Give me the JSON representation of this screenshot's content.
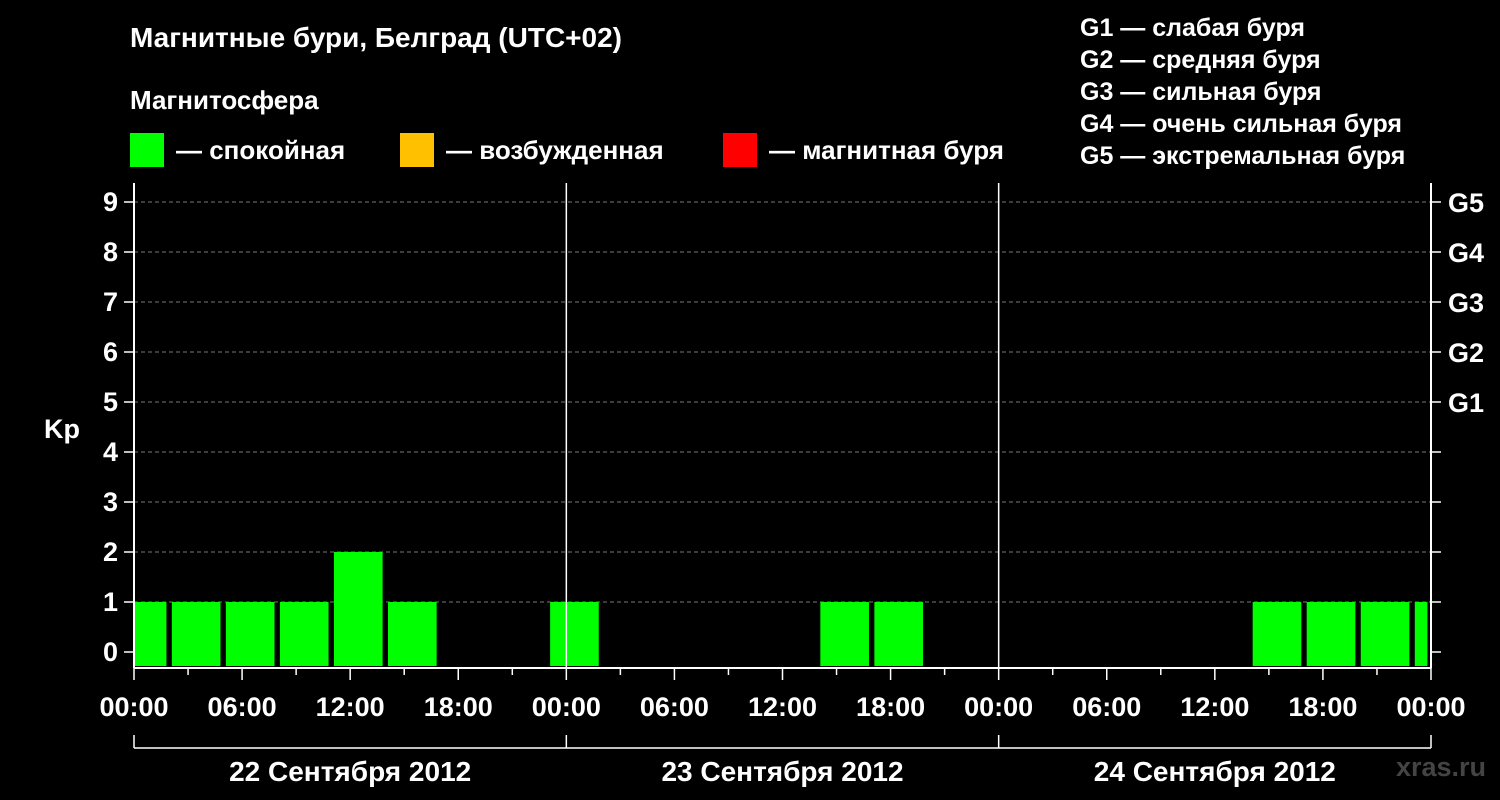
{
  "title": "Магнитные бури, Белград (UTC+02)",
  "magnetosphere": {
    "title": "Магнитосфера",
    "legend": [
      {
        "label": "— спокойная",
        "color": "#00ff00"
      },
      {
        "label": "— возбужденная",
        "color": "#ffc000"
      },
      {
        "label": "— магнитная буря",
        "color": "#ff0000"
      }
    ]
  },
  "g_scale_legend": [
    "G1 — слабая буря",
    "G2 — средняя буря",
    "G3 — сильная буря",
    "G4 — очень сильная буря",
    "G5 — экстремальная буря"
  ],
  "watermark": "xras.ru",
  "chart_data": {
    "type": "bar",
    "ylabel": "Kp",
    "xlabel": "",
    "ylim": [
      0,
      9
    ],
    "xlim_hours": [
      0,
      72
    ],
    "bar_width_hours": 3,
    "y_ticks": [
      0,
      1,
      2,
      3,
      4,
      5,
      6,
      7,
      8,
      9
    ],
    "right_axis_labels": [
      {
        "kp": 5,
        "label": "G1"
      },
      {
        "kp": 6,
        "label": "G2"
      },
      {
        "kp": 7,
        "label": "G3"
      },
      {
        "kp": 8,
        "label": "G4"
      },
      {
        "kp": 9,
        "label": "G5"
      }
    ],
    "x_tick_labels": [
      {
        "hour": 0,
        "label": "00:00"
      },
      {
        "hour": 6,
        "label": "06:00"
      },
      {
        "hour": 12,
        "label": "12:00"
      },
      {
        "hour": 18,
        "label": "18:00"
      },
      {
        "hour": 24,
        "label": "00:00"
      },
      {
        "hour": 30,
        "label": "06:00"
      },
      {
        "hour": 36,
        "label": "12:00"
      },
      {
        "hour": 42,
        "label": "18:00"
      },
      {
        "hour": 48,
        "label": "00:00"
      },
      {
        "hour": 54,
        "label": "06:00"
      },
      {
        "hour": 60,
        "label": "12:00"
      },
      {
        "hour": 66,
        "label": "18:00"
      },
      {
        "hour": 72,
        "label": "00:00"
      }
    ],
    "days": [
      "22 Сентября 2012",
      "23 Сентября 2012",
      "24 Сентября 2012"
    ],
    "grid": true,
    "series": [
      {
        "values": [
          {
            "start": 0,
            "end": 1.8,
            "kp": 1,
            "level": "спокойная"
          },
          {
            "start": 2.1,
            "end": 4.8,
            "kp": 1,
            "level": "спокойная"
          },
          {
            "start": 5.1,
            "end": 7.8,
            "kp": 1,
            "level": "спокойная"
          },
          {
            "start": 8.1,
            "end": 10.8,
            "kp": 1,
            "level": "спокойная"
          },
          {
            "start": 11.1,
            "end": 13.8,
            "kp": 2,
            "level": "спокойная"
          },
          {
            "start": 14.1,
            "end": 16.8,
            "kp": 1,
            "level": "спокойная"
          },
          {
            "start": 23.1,
            "end": 25.8,
            "kp": 1,
            "level": "спокойная"
          },
          {
            "start": 38.1,
            "end": 40.8,
            "kp": 1,
            "level": "спокойная"
          },
          {
            "start": 41.1,
            "end": 43.8,
            "kp": 1,
            "level": "спокойная"
          },
          {
            "start": 62.1,
            "end": 64.8,
            "kp": 1,
            "level": "спокойная"
          },
          {
            "start": 65.1,
            "end": 67.8,
            "kp": 1,
            "level": "спокойная"
          },
          {
            "start": 68.1,
            "end": 70.8,
            "kp": 1,
            "level": "спокойная"
          },
          {
            "start": 71.1,
            "end": 71.8,
            "kp": 1,
            "level": "спокойная"
          }
        ]
      }
    ]
  }
}
